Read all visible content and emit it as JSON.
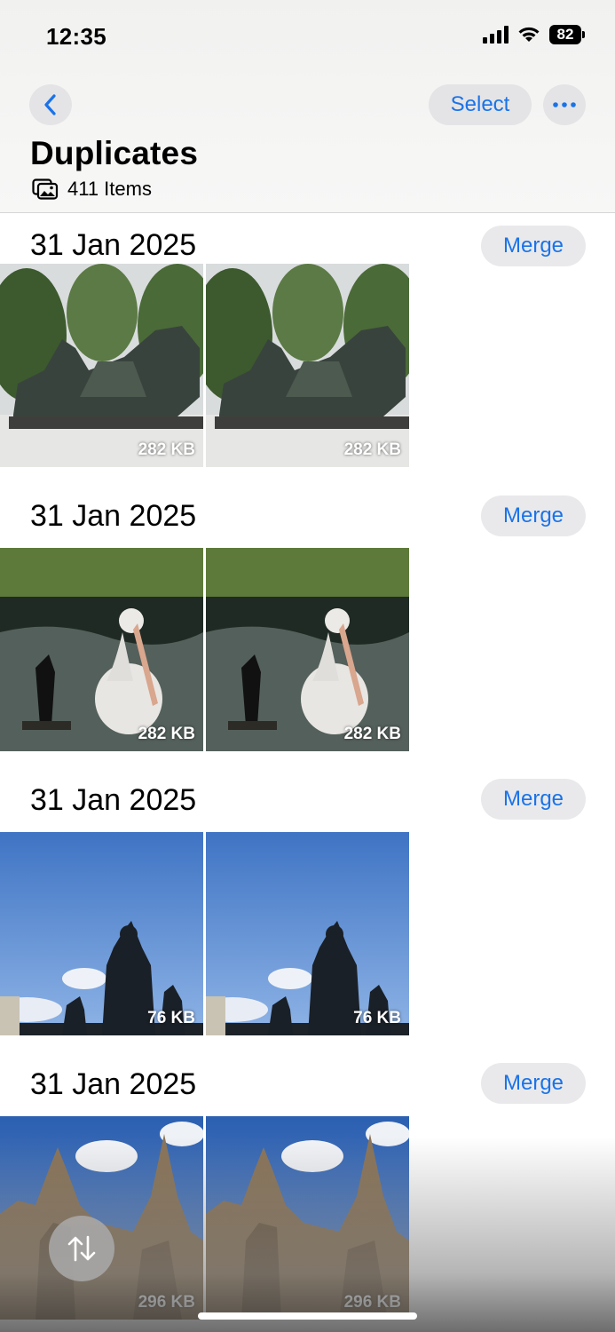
{
  "status_bar": {
    "time": "12:35",
    "battery": "82"
  },
  "header": {
    "back_icon": "chevron-left-icon",
    "select_label": "Select",
    "more_icon": "ellipsis-icon",
    "title": "Duplicates",
    "items_icon": "photo-stack-icon",
    "items_count": "411 Items"
  },
  "groups": [
    {
      "date": "31 Jan 2025",
      "merge_label": "Merge",
      "photos": [
        {
          "size": "282 KB",
          "subject": "statue-lions"
        },
        {
          "size": "282 KB",
          "subject": "statue-lions"
        }
      ]
    },
    {
      "date": "31 Jan 2025",
      "merge_label": "Merge",
      "photos": [
        {
          "size": "282 KB",
          "subject": "pelican-pond"
        },
        {
          "size": "282 KB",
          "subject": "pelican-pond"
        }
      ]
    },
    {
      "date": "31 Jan 2025",
      "merge_label": "Merge",
      "photos": [
        {
          "size": "76 KB",
          "subject": "monument-sky"
        },
        {
          "size": "76 KB",
          "subject": "monument-sky"
        }
      ]
    },
    {
      "date": "31 Jan 2025",
      "merge_label": "Merge",
      "photos": [
        {
          "size": "296 KB",
          "subject": "cathedral"
        },
        {
          "size": "296 KB",
          "subject": "cathedral"
        }
      ]
    }
  ],
  "footer": {
    "sort_icon": "sort-arrows-icon"
  },
  "colors": {
    "accent": "#1a73e8",
    "button_bg": "#e9e9eb"
  }
}
